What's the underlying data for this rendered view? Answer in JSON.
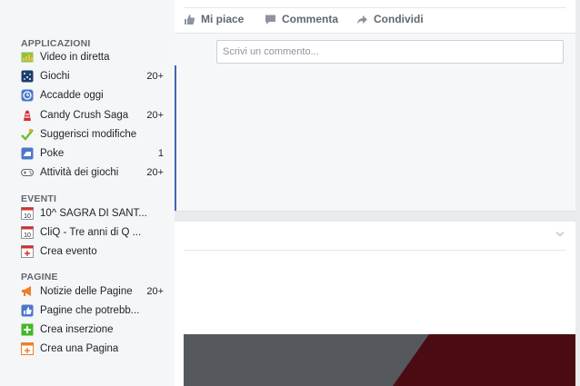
{
  "sidebar": {
    "apps": {
      "title": "APPLICAZIONI",
      "items": [
        {
          "label": "Video in diretta",
          "count": "",
          "icon": "live-video-icon"
        },
        {
          "label": "Giochi",
          "count": "20+",
          "icon": "games-icon"
        },
        {
          "label": "Accadde oggi",
          "count": "",
          "icon": "on-this-day-icon"
        },
        {
          "label": "Candy Crush Saga",
          "count": "20+",
          "icon": "candy-icon"
        },
        {
          "label": "Suggerisci modifiche",
          "count": "",
          "icon": "pencil-icon"
        },
        {
          "label": "Poke",
          "count": "1",
          "icon": "poke-icon"
        },
        {
          "label": "Attività dei giochi",
          "count": "20+",
          "icon": "gamepad-icon"
        }
      ]
    },
    "events": {
      "title": "EVENTI",
      "items": [
        {
          "label": "10^ SAGRA DI SANT...",
          "icon": "calendar-icon"
        },
        {
          "label": "CliQ - Tre anni di Q ...",
          "icon": "calendar-icon"
        },
        {
          "label": "Crea evento",
          "icon": "create-event-icon"
        }
      ]
    },
    "pages": {
      "title": "PAGINE",
      "items": [
        {
          "label": "Notizie delle Pagine",
          "count": "20+",
          "icon": "megaphone-icon"
        },
        {
          "label": "Pagine che potrebb...",
          "count": "",
          "icon": "like-page-icon"
        },
        {
          "label": "Crea inserzione",
          "count": "",
          "icon": "plus-icon"
        },
        {
          "label": "Crea una Pagina",
          "count": "",
          "icon": "create-page-icon"
        }
      ]
    }
  },
  "post": {
    "actions": {
      "like": "Mi piace",
      "comment": "Commenta",
      "share": "Condividi"
    },
    "comment_placeholder": "Scrivi un commento..."
  },
  "colors": {
    "accent": "#4267b2",
    "image_gray": "#55585d",
    "image_red": "#4a0c12"
  }
}
